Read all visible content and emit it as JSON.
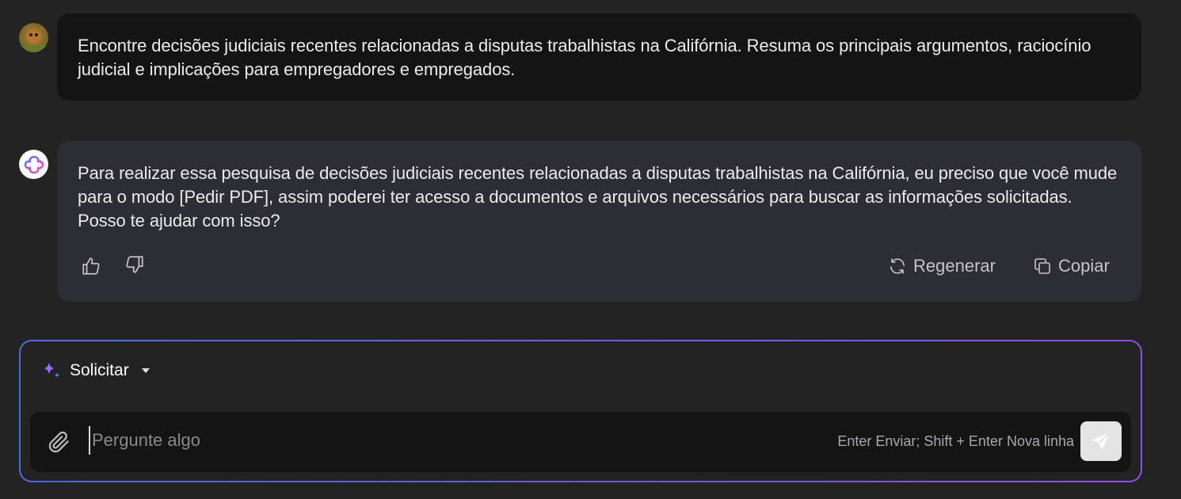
{
  "conversation": {
    "user_message": "Encontre decisões judiciais recentes relacionadas a disputas trabalhistas na Califórnia. Resuma os principais argumentos, raciocínio judicial e implicações para empregadores e empregados.",
    "bot_message": "Para realizar essa pesquisa de decisões judiciais recentes relacionadas a disputas trabalhistas na Califórnia, eu preciso que você mude para o modo [Pedir PDF], assim poderei ter acesso a documentos e arquivos necessários para buscar as informações solicitadas. Posso te ajudar com isso?"
  },
  "actions": {
    "like_icon": "thumbs-up-icon",
    "dislike_icon": "thumbs-down-icon",
    "regenerate_label": "Regenerar",
    "copy_label": "Copiar"
  },
  "composer": {
    "mode_label": "Solicitar",
    "placeholder": "Pergunte algo",
    "value": "",
    "hint": "Enter Enviar; Shift + Enter Nova linha"
  },
  "colors": {
    "background": "#232323",
    "user_bubble": "#141414",
    "bot_bubble": "#2d2d35",
    "gradient_start": "#4c6bd8",
    "gradient_end": "#8f4fe8"
  }
}
